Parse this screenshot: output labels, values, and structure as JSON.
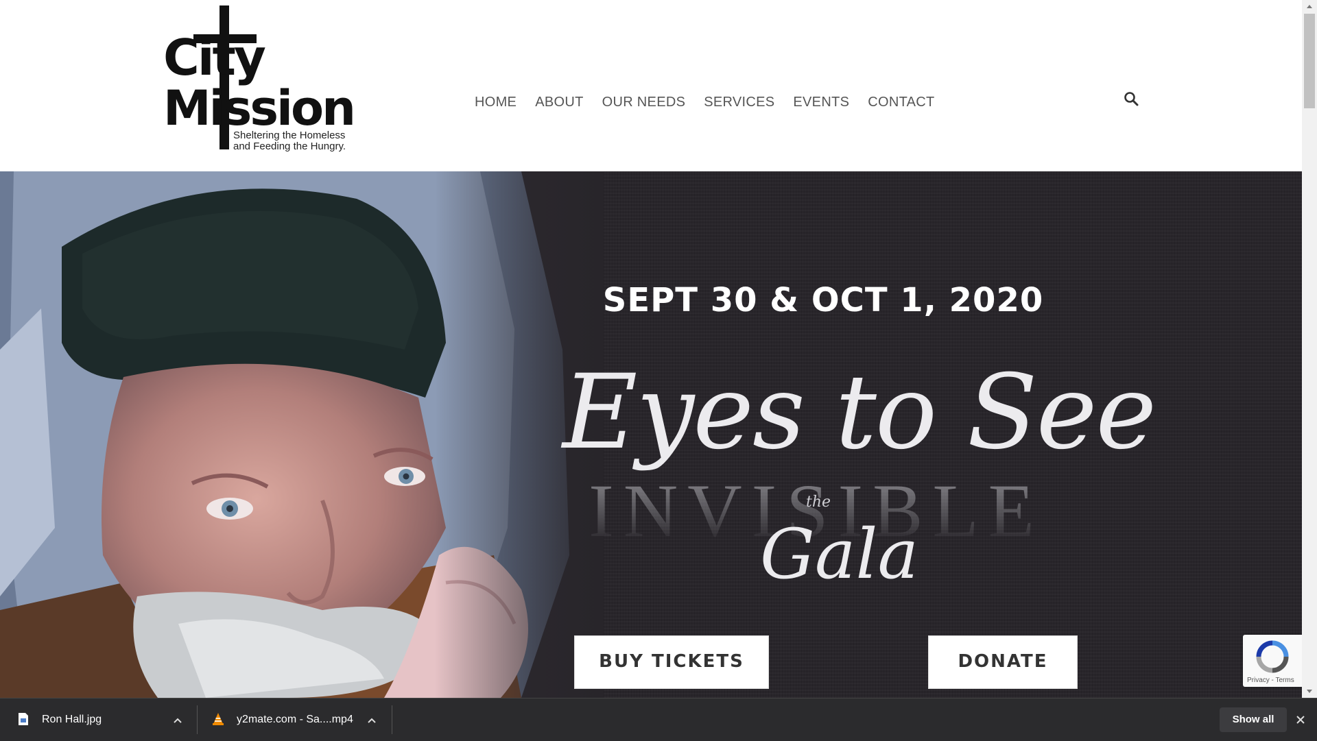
{
  "header": {
    "logo": {
      "line1": "City",
      "line2": "Mission",
      "tagline_1": "Sheltering the Homeless",
      "tagline_2": "and Feeding the Hungry."
    },
    "nav": [
      "HOME",
      "ABOUT",
      "OUR NEEDS",
      "SERVICES",
      "EVENTS",
      "CONTACT"
    ],
    "search_icon": "search-icon"
  },
  "hero": {
    "date": "SEPT 30 & OCT 1, 2020",
    "title_script": "Eyes to See",
    "title_the": "the",
    "title_invisible": "INVISIBLE",
    "title_gala": "Gala",
    "buttons": {
      "buy": "BUY TICKETS",
      "donate": "DONATE"
    },
    "recaptcha_terms": "Privacy - Terms"
  },
  "downloads": {
    "items": [
      {
        "name": "Ron Hall.jpg",
        "icon": "image-file-icon"
      },
      {
        "name": "y2mate.com - Sa....mp4",
        "icon": "vlc-cone-icon"
      }
    ],
    "show_all": "Show all",
    "close_icon": "close-icon"
  },
  "colors": {
    "hero_bg": "#28252a",
    "download_bar": "#2b2b2d"
  }
}
